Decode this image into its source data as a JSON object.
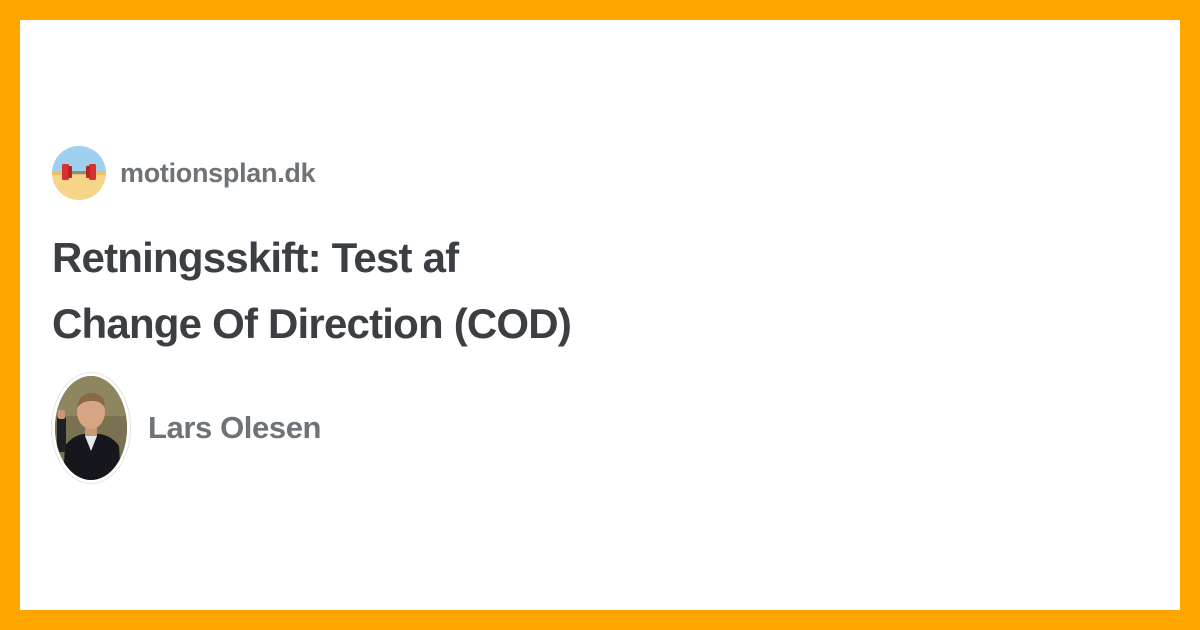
{
  "site": {
    "name": "motionsplan.dk",
    "logo_icon": "dumbbell-beach-icon"
  },
  "article": {
    "title_line1": "Retningsskift: Test af",
    "title_line2": "Change Of Direction (COD)"
  },
  "author": {
    "name": "Lars Olesen",
    "avatar_icon": "author-photo"
  },
  "colors": {
    "frame": "#ffa500",
    "card": "#ffffff",
    "title_text": "#3b3e42",
    "meta_text": "#6e7378"
  }
}
